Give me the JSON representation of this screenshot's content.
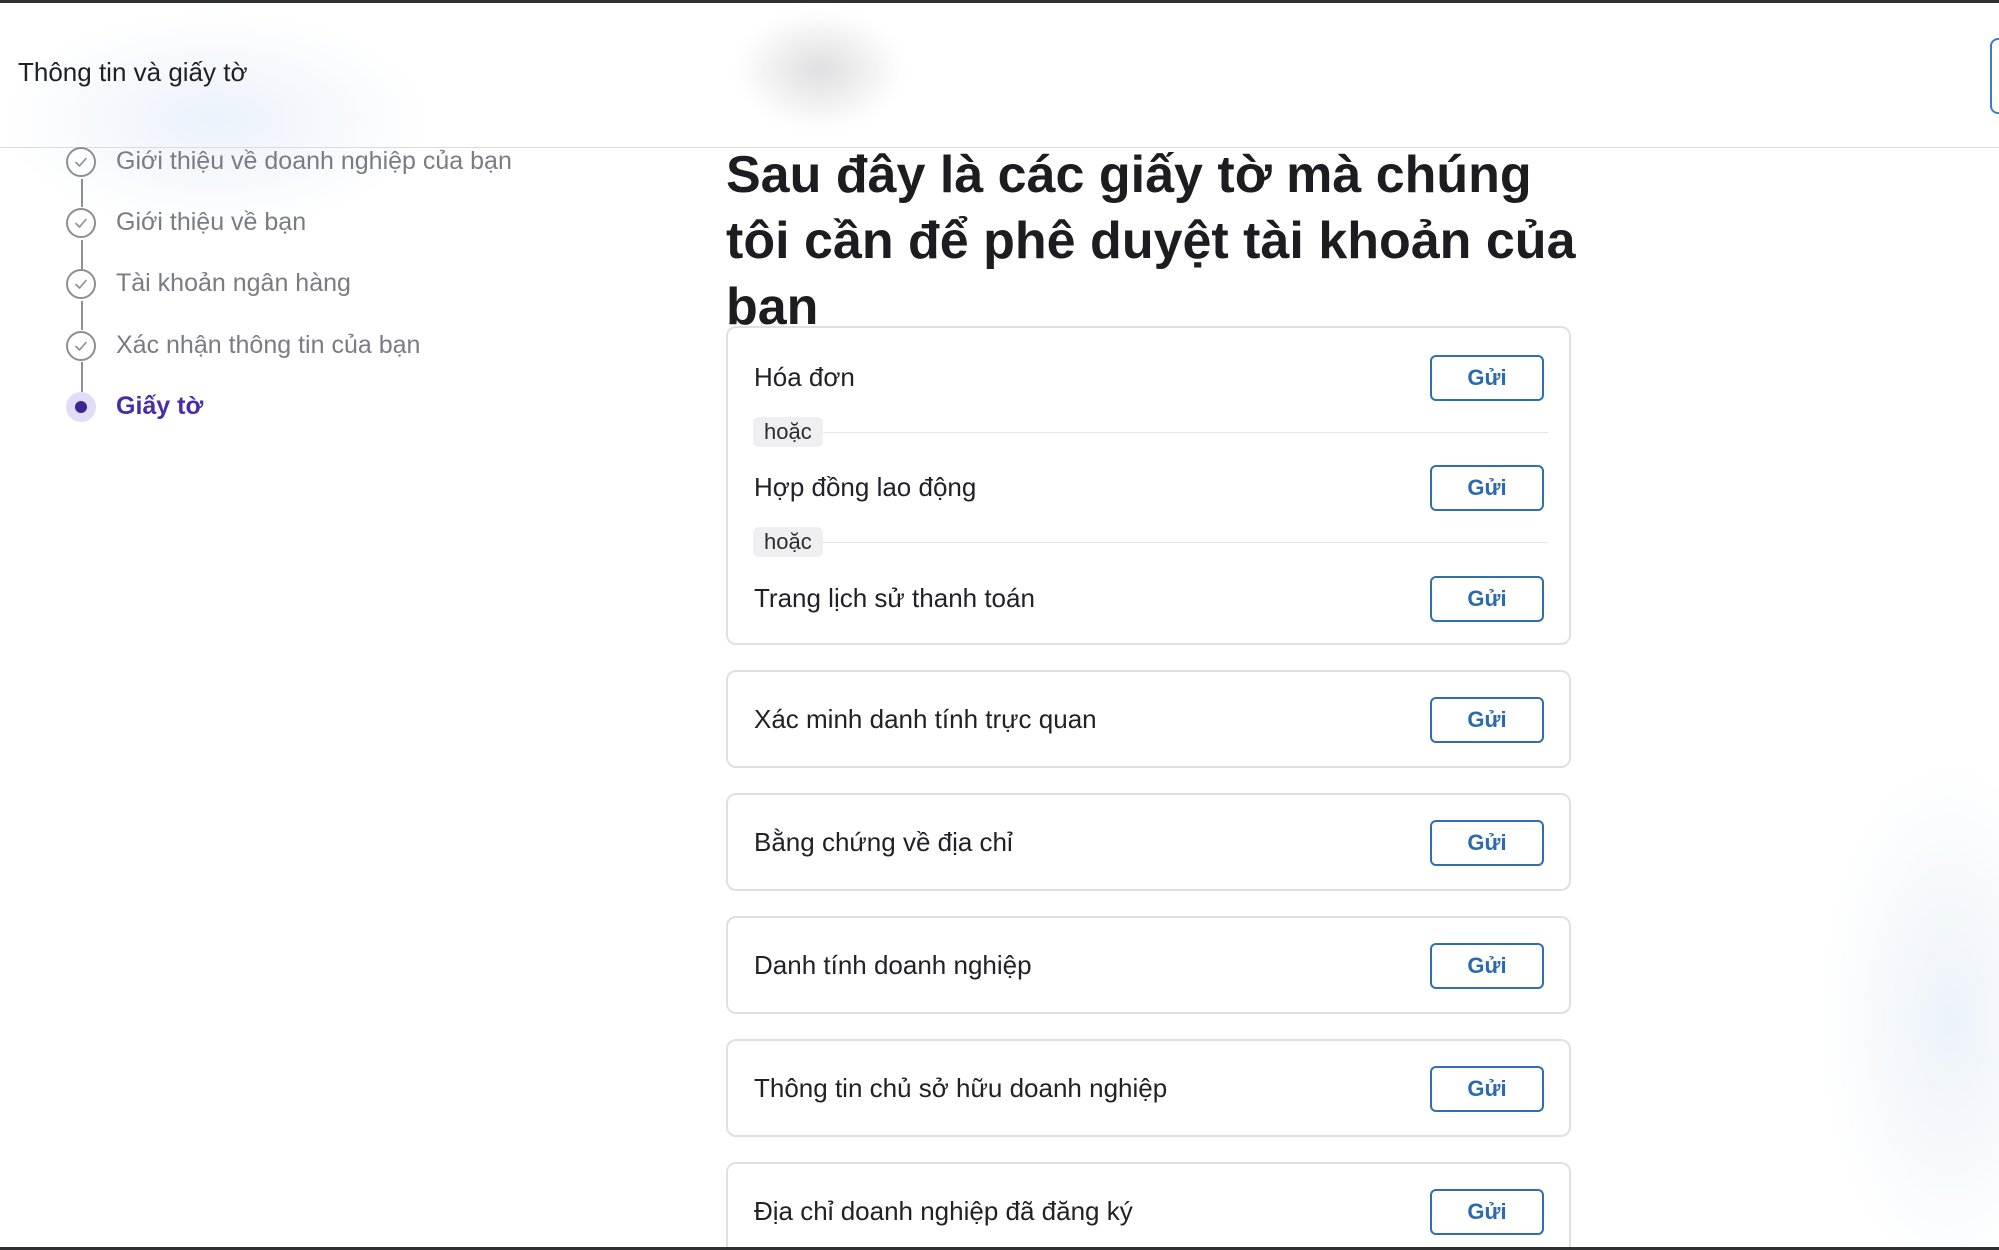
{
  "header": {
    "title": "Thông tin và giấy tờ"
  },
  "steps": [
    {
      "label": "Giới thiệu về doanh nghiệp của bạn",
      "status": "completed",
      "icon": "check-icon"
    },
    {
      "label": "Giới thiệu về bạn",
      "status": "completed",
      "icon": "check-icon"
    },
    {
      "label": "Tài khoản ngân hàng",
      "status": "completed",
      "icon": "check-icon"
    },
    {
      "label": "Xác nhận thông tin của bạn",
      "status": "completed",
      "icon": "check-icon"
    },
    {
      "label": "Giấy tờ",
      "status": "current",
      "icon": "current-step-dot-icon"
    }
  ],
  "main": {
    "heading": "Sau đây là các giấy tờ mà chúng tôi cần để phê duyệt tài khoản của bạn",
    "document_groups": [
      {
        "items": [
          {
            "label": "Hóa đơn",
            "button": "Gửi"
          },
          {
            "label": "Hợp đồng lao động",
            "button": "Gửi"
          },
          {
            "label": "Trang lịch sử thanh toán",
            "button": "Gửi"
          }
        ],
        "separator_label": "hoặc"
      },
      {
        "items": [
          {
            "label": "Xác minh danh tính trực quan",
            "button": "Gửi"
          }
        ]
      },
      {
        "items": [
          {
            "label": "Bằng chứng về địa chỉ",
            "button": "Gửi"
          }
        ]
      },
      {
        "items": [
          {
            "label": "Danh tính doanh nghiệp",
            "button": "Gửi"
          }
        ]
      },
      {
        "items": [
          {
            "label": "Thông tin chủ sở hữu doanh nghiệp",
            "button": "Gửi"
          }
        ]
      },
      {
        "items": [
          {
            "label": "Địa chỉ doanh nghiệp đã đăng ký",
            "button": "Gửi"
          }
        ]
      }
    ]
  },
  "colors": {
    "accent_purple": "#4a2ca8",
    "button_blue": "#2a6aad",
    "completed_gray": "#8e8e96"
  }
}
